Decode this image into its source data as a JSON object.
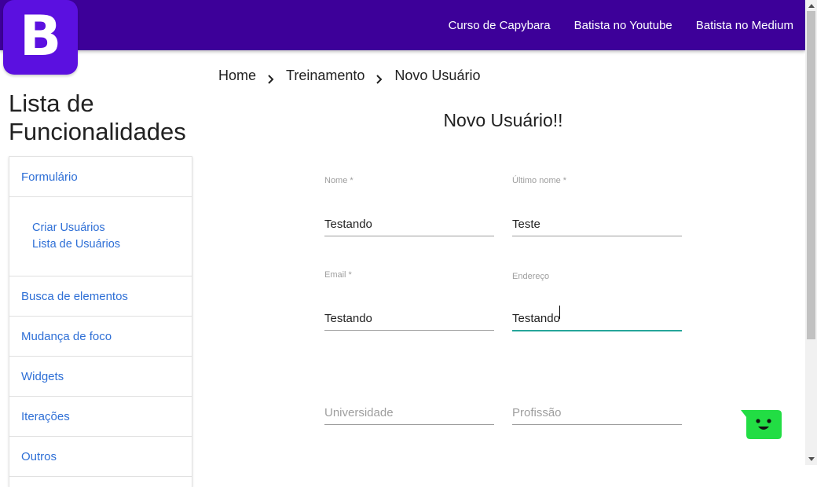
{
  "logo": {
    "letter": "B"
  },
  "nav": {
    "links": [
      "Curso de Capybara",
      "Batista no Youtube",
      "Batista no Medium"
    ]
  },
  "breadcrumb": [
    "Home",
    "Treinamento",
    "Novo Usuário"
  ],
  "sidebar": {
    "heading": "Lista de Funcionalidades",
    "items": [
      {
        "label": "Formulário"
      },
      {
        "label": "Busca de elementos"
      },
      {
        "label": "Mudança de foco"
      },
      {
        "label": "Widgets"
      },
      {
        "label": "Iterações"
      },
      {
        "label": "Outros"
      }
    ],
    "subitems": [
      {
        "label": "Criar Usuários"
      },
      {
        "label": "Lista de Usuários"
      }
    ]
  },
  "form": {
    "title": "Novo Usuário!!",
    "fields": {
      "nome": {
        "label": "Nome *",
        "value": "Testando"
      },
      "ultimo_nome": {
        "label": "Último nome *",
        "value": "Teste"
      },
      "email": {
        "label": "Email *",
        "value": "Testando"
      },
      "endereco": {
        "label": "Endereço",
        "value": "Testando"
      },
      "universidade": {
        "placeholder": "Universidade",
        "value": ""
      },
      "profissao": {
        "placeholder": "Profissão",
        "value": ""
      }
    }
  },
  "colors": {
    "navbar": "#3d0099",
    "logo": "#5b10e0",
    "link": "#2e6fd6",
    "focus": "#26a69a",
    "chat": "#22dd44"
  }
}
